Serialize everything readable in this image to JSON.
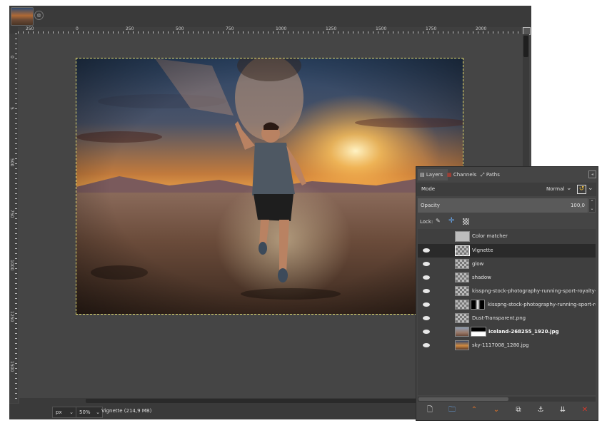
{
  "image_window": {
    "ruler_labels": [
      "250",
      "0",
      "250",
      "500",
      "750",
      "1000",
      "1250",
      "1500",
      "1750",
      "2000"
    ],
    "vruler_labels": [
      "0",
      "5",
      "500",
      "750",
      "1000",
      "1250",
      "1500"
    ]
  },
  "status": {
    "unit": "px",
    "zoom": "50%",
    "layer_info": "Vignette (214,9 MB)"
  },
  "layers_panel": {
    "tabs": [
      {
        "label": "Layers"
      },
      {
        "label": "Channels"
      },
      {
        "label": "Paths"
      }
    ],
    "mode_label": "Mode",
    "mode_value": "Normal",
    "opacity_label": "Opacity",
    "opacity_value": "100,0",
    "lock_label": "Lock:",
    "layers": [
      {
        "name": "Color matcher",
        "visible": false
      },
      {
        "name": "Vignette",
        "visible": true,
        "selected": true
      },
      {
        "name": "glow",
        "visible": true
      },
      {
        "name": "shadow",
        "visible": true
      },
      {
        "name": "kisspng-stock-photography-running-sport-royalty-free",
        "visible": true
      },
      {
        "name": "kisspng-stock-photography-running-sport-roy",
        "visible": true
      },
      {
        "name": "Dust-Transparent.png",
        "visible": true
      },
      {
        "name": "iceland-268255_1920.jpg",
        "visible": true
      },
      {
        "name": "sky-1117008_1280.jpg",
        "visible": true
      }
    ]
  },
  "colors": {
    "accent_orange": "#e0742a",
    "delete_red": "#d33a2c",
    "selection_yellow": "#e8e070"
  }
}
